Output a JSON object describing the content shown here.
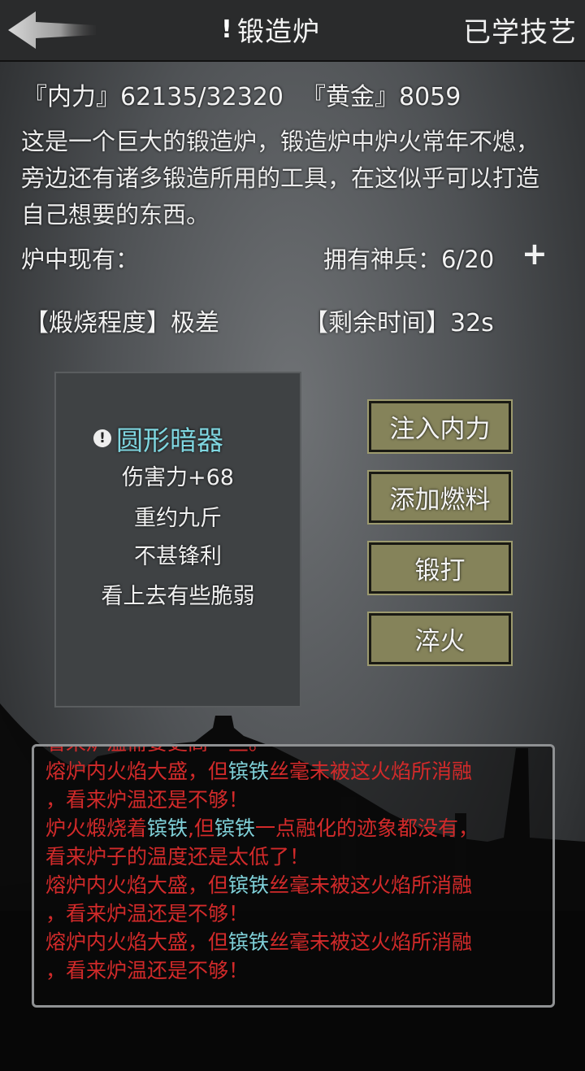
{
  "header": {
    "title": "锻造炉",
    "learned_label": "已学技艺"
  },
  "stats": {
    "neili_label": "『内力』",
    "neili_value": "62135/32320",
    "gold_label": "『黄金』",
    "gold_value": "8059"
  },
  "description": "这是一个巨大的锻造炉，锻造炉中炉火常年不熄，旁边还有诸多锻造所用的工具，在这似乎可以打造自己想要的东西。",
  "furnace": {
    "label": "炉中现有：",
    "weapons_label": "拥有神兵：",
    "weapons_value": "6/20",
    "plus": "+",
    "burn_label": "【煅烧程度】",
    "burn_value": "极差",
    "remain_label": "【剩余时间】",
    "remain_value": "32s"
  },
  "item": {
    "alert": "!",
    "name": "圆形暗器",
    "lines": [
      "伤害力+68",
      "重约九斤",
      "不甚锋利",
      "看上去有些脆弱"
    ]
  },
  "actions": [
    "注入内力",
    "添加燃料",
    "锻打",
    "淬火"
  ],
  "log": [
    {
      "segments": [
        {
          "text": "看来炉温需要更高一些。",
          "hl": false
        }
      ]
    },
    {
      "segments": [
        {
          "text": "熔炉内火焰大盛，但",
          "hl": false
        },
        {
          "text": "镔铁",
          "hl": true
        },
        {
          "text": "丝毫未被这火焰所消融",
          "hl": false
        }
      ]
    },
    {
      "segments": [
        {
          "text": "，看来炉温还是不够！",
          "hl": false
        }
      ]
    },
    {
      "segments": [
        {
          "text": "炉火煅烧着",
          "hl": false
        },
        {
          "text": "镔铁",
          "hl": true
        },
        {
          "text": ",但",
          "hl": false
        },
        {
          "text": "镔铁",
          "hl": true
        },
        {
          "text": "一点融化的迹象都没有，",
          "hl": false
        }
      ]
    },
    {
      "segments": [
        {
          "text": "看来炉子的温度还是太低了！",
          "hl": false
        }
      ]
    },
    {
      "segments": [
        {
          "text": "熔炉内火焰大盛，但",
          "hl": false
        },
        {
          "text": "镔铁",
          "hl": true
        },
        {
          "text": "丝毫未被这火焰所消融",
          "hl": false
        }
      ]
    },
    {
      "segments": [
        {
          "text": "，看来炉温还是不够！",
          "hl": false
        }
      ]
    },
    {
      "segments": [
        {
          "text": "熔炉内火焰大盛，但",
          "hl": false
        },
        {
          "text": "镔铁",
          "hl": true
        },
        {
          "text": "丝毫未被这火焰所消融",
          "hl": false
        }
      ]
    },
    {
      "segments": [
        {
          "text": "，看来炉温还是不够！",
          "hl": false
        }
      ]
    }
  ],
  "icons": {
    "back": "back-arrow-icon",
    "alert": "exclamation-icon"
  },
  "colors": {
    "item_name": "#7fd6e0",
    "log_text": "#d22a2a",
    "log_highlight": "#7fd0d8",
    "button": "#85835a"
  }
}
